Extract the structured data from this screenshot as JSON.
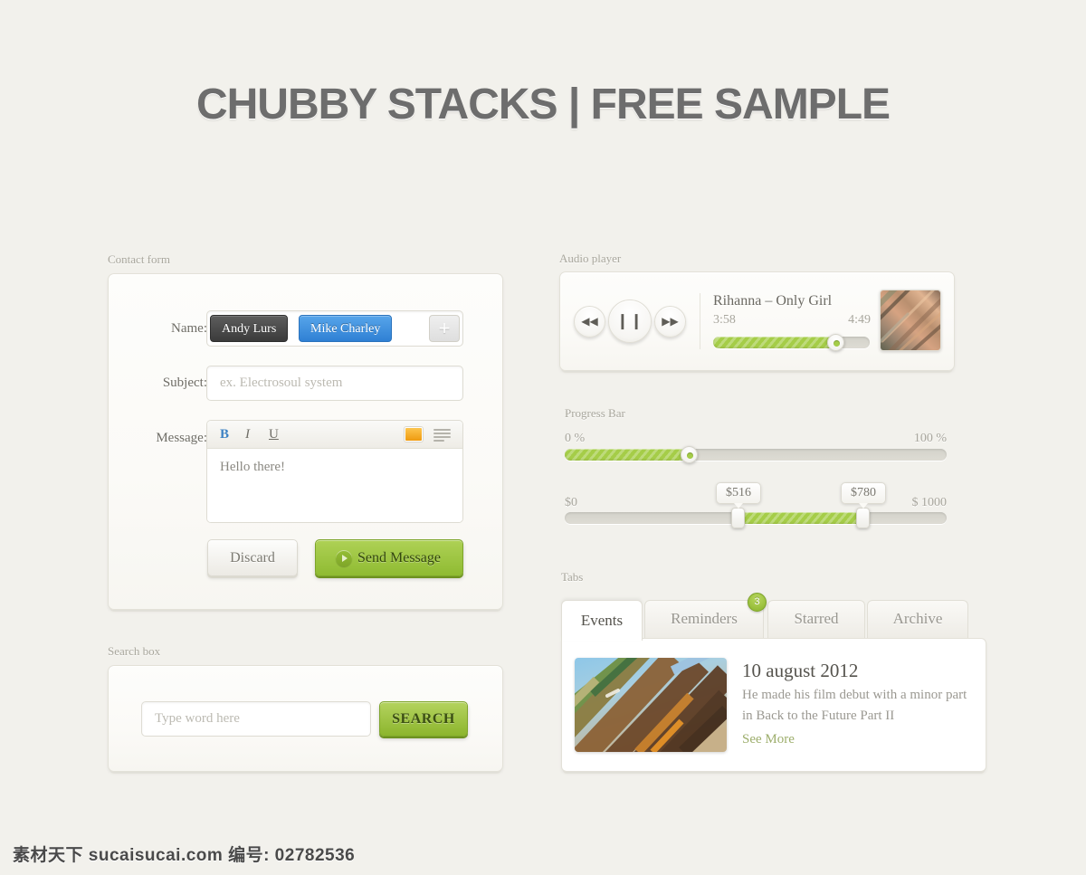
{
  "page": {
    "title": "CHUBBY STACKS | FREE SAMPLE",
    "background": "#f2f1ec",
    "accent": "#a5cd48"
  },
  "contact_form": {
    "caption": "Contact form",
    "name_label": "Name:",
    "tokens": [
      {
        "label": "Andy Lurs",
        "color": "#4a4a4a"
      },
      {
        "label": "Mike Charley",
        "color": "#3d91e0"
      }
    ],
    "add_token": "+",
    "subject_label": "Subject:",
    "subject_value": "",
    "subject_placeholder": "ex. Electrosoul system",
    "message_label": "Message:",
    "toolbar": {
      "bold": "B",
      "italic": "I",
      "underline": "U",
      "color_swatch": "#f0a51e"
    },
    "message_value": "Hello there!",
    "discard_label": "Discard",
    "send_label": "Send Message"
  },
  "search_box": {
    "caption": "Search box",
    "input_value": "",
    "input_placeholder": "Type word here",
    "button_label": "SEARCH"
  },
  "audio_player": {
    "caption": "Audio player",
    "prev_glyph": "◀◀",
    "play_glyph": "❙❙",
    "next_glyph": "▶▶",
    "track_title": "Rihanna – Only Girl",
    "time_current": "3:58",
    "time_total": "4:49",
    "progress_percent": 78
  },
  "progress_section": {
    "caption": "Progress Bar",
    "bar": {
      "min_label": "0 %",
      "max_label": "100 %",
      "value_percent": 33
    },
    "range": {
      "min_label": "$0",
      "max_label": "$ 1000",
      "low_tooltip": "$516",
      "high_tooltip": "$780",
      "low_value": 516,
      "high_value": 780
    }
  },
  "tabs_section": {
    "caption": "Tabs",
    "tabs": [
      {
        "label": "Events",
        "active": true,
        "badge": ""
      },
      {
        "label": "Reminders",
        "active": false,
        "badge": "3"
      },
      {
        "label": "Starred",
        "active": false,
        "badge": ""
      },
      {
        "label": "Archive",
        "active": false,
        "badge": ""
      }
    ],
    "content": {
      "date": "10 august 2012",
      "description": "He made his film debut with a minor part in Back to the Future Part II",
      "more_link": "See More"
    }
  },
  "watermark": {
    "text": "素材天下 sucaisucai.com  编号: 02782536"
  }
}
